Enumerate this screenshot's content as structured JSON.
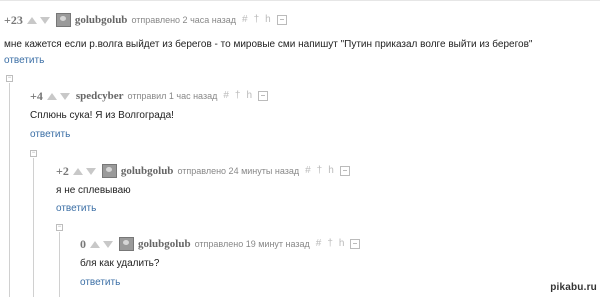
{
  "comments": [
    {
      "score": "+23",
      "username": "golubgolub",
      "meta": "отправлено 2 часа назад",
      "text": "мне кажется если р.волга выйдет из берегов - то мировые сми напишут \"Путин приказал волге выйти из берегов\"",
      "reply_label": "ответить"
    },
    {
      "score": "+4",
      "username": "spedcyber",
      "meta": "отправил 1 час назад",
      "text": "Сплюнь сука! Я из Волгограда!",
      "reply_label": "ответить"
    },
    {
      "score": "+2",
      "username": "golubgolub",
      "meta": "отправлено 24 минуты назад",
      "text": "я не сплевываю",
      "reply_label": "ответить"
    },
    {
      "score": "0",
      "username": "golubgolub",
      "meta": "отправлено 19 минут назад",
      "text": "бля как удалить?",
      "reply_label": "ответить"
    }
  ],
  "icons": {
    "hash": "#",
    "dagger": "†",
    "h": "h",
    "collapse": "−"
  },
  "watermark": "pikabu.ru",
  "colors": {
    "link": "#3a6ea5",
    "arrow": "#c8c8c8",
    "meta": "#888888"
  }
}
